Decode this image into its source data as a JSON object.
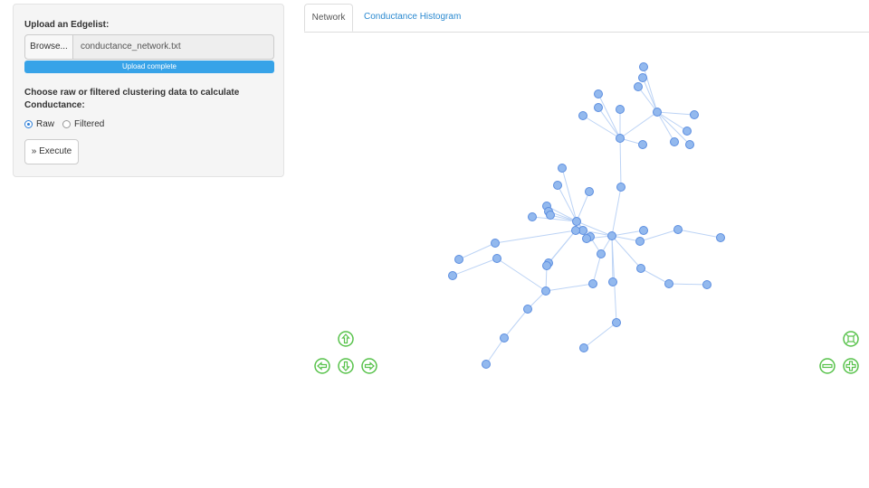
{
  "sidebar": {
    "upload_label": "Upload an Edgelist:",
    "browse_label": "Browse...",
    "file_name": "conductance_network.txt",
    "progress_text": "Upload complete",
    "progress": 1.0,
    "choose_label": "Choose raw or filtered clustering data to calculate Conductance:",
    "radio_raw": "Raw",
    "radio_filtered": "Filtered",
    "selected": "Raw",
    "execute_label": "» Execute"
  },
  "tabs": [
    {
      "label": "Network",
      "active": true
    },
    {
      "label": "Conductance Histogram",
      "active": false
    }
  ],
  "colors": {
    "accent": "#37a3e8",
    "node_fill": "#93b9ee",
    "node_stroke": "#5c8ee0",
    "edge": "#bcd3f5",
    "nav_green": "#57c24a"
  },
  "network": {
    "node_count": 62,
    "edge_count": 70
  },
  "navigation": {
    "icons": [
      "arrow-up-icon",
      "arrow-left-icon",
      "arrow-down-icon",
      "arrow-right-icon",
      "zoom-extent-icon",
      "zoom-out-icon",
      "zoom-in-icon"
    ]
  }
}
